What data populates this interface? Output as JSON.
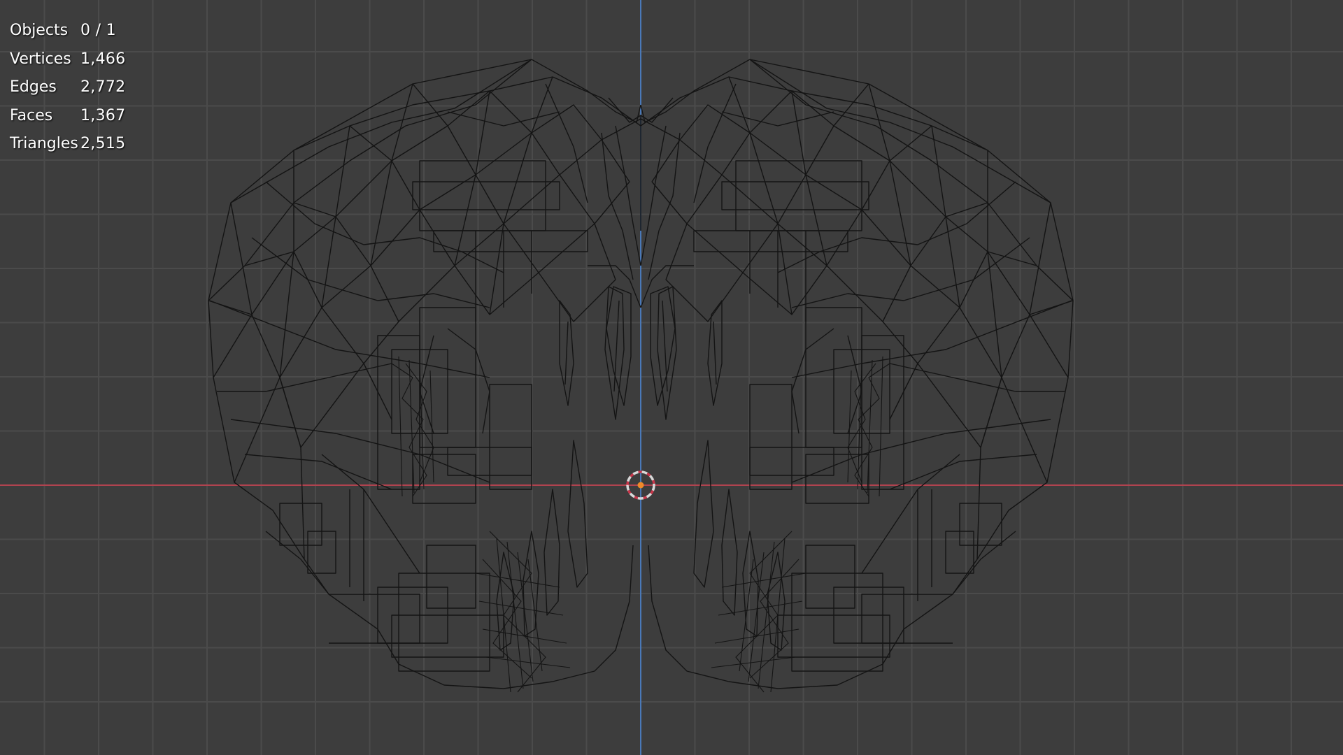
{
  "viewport": {
    "colors": {
      "background": "#3d3d3d",
      "grid": "#4b4b4b",
      "x_axis": "#b0434f",
      "y_axis": "#4a79b8",
      "wireframe": "#141414",
      "origin_ring": "#d8d8d8",
      "origin_dot": "#f08a2a"
    },
    "stats": [
      {
        "label": "Objects",
        "value": "0 / 1"
      },
      {
        "label": "Vertices",
        "value": "1,466"
      },
      {
        "label": "Edges",
        "value": "2,772"
      },
      {
        "label": "Faces",
        "value": "1,367"
      },
      {
        "label": "Triangles",
        "value": "2,515"
      }
    ],
    "icons": {
      "origin": "origin-cursor-icon"
    }
  }
}
